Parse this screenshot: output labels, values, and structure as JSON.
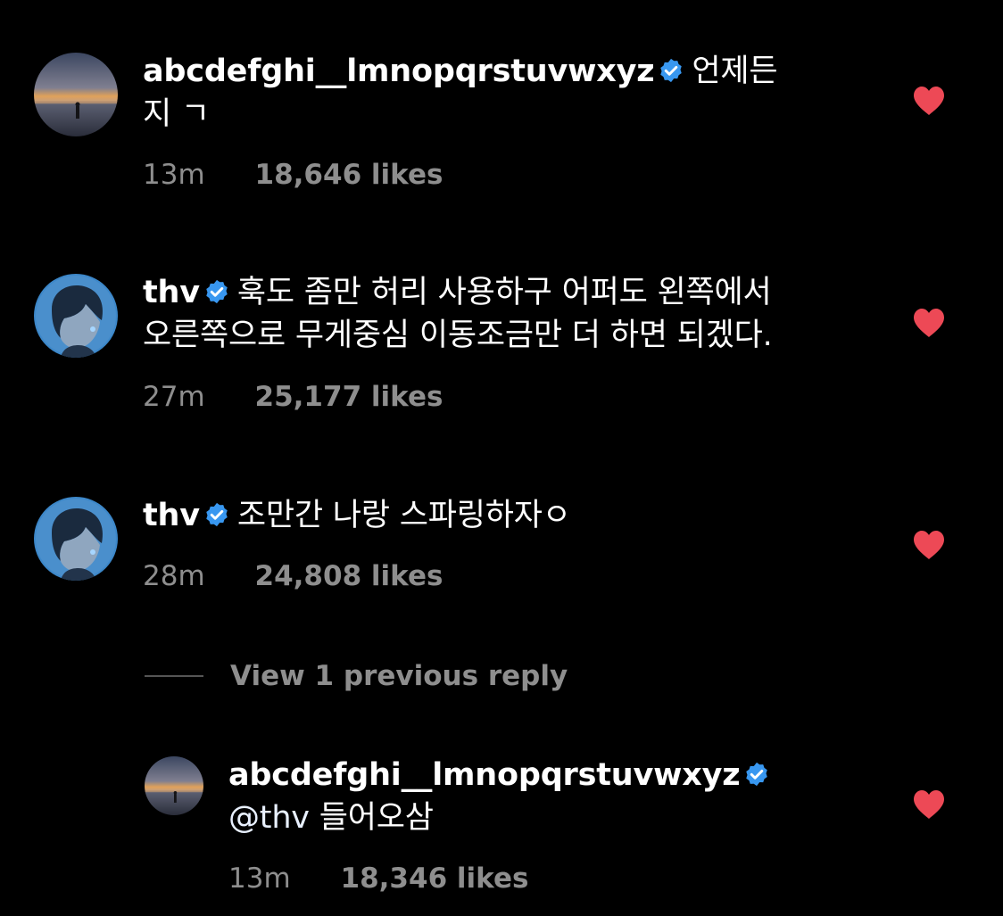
{
  "colors": {
    "background": "#000000",
    "text": "#ffffff",
    "muted": "#8e8e8e",
    "verified_badge": "#3897f0",
    "heart": "#ed4956"
  },
  "icons": {
    "verified": "verified-badge-icon",
    "like": "heart-filled-icon"
  },
  "comments": [
    {
      "username": "abcdefghi__lmnopqrstuvwxyz",
      "verified": true,
      "text_line1": "언제든",
      "text_line2": "지 ㄱ",
      "time": "13m",
      "likes": "18,646 likes",
      "liked": true
    },
    {
      "username": "thv",
      "verified": true,
      "text_line1": "훅도 좀만 허리 사용하구 어퍼도 왼쪽에서",
      "text_line2": "오른쪽으로 무게중심 이동조금만 더 하면 되겠다.",
      "time": "27m",
      "likes": "25,177 likes",
      "liked": true
    },
    {
      "username": "thv",
      "verified": true,
      "text_line1": "조만간 나랑 스파링하자ㅇ",
      "time": "28m",
      "likes": "24,808 likes",
      "liked": true
    }
  ],
  "view_replies": "View 1 previous reply",
  "reply": {
    "username": "abcdefghi__lmnopqrstuvwxyz",
    "verified": true,
    "mention": "@thv",
    "text": " 들어오삼",
    "time": "13m",
    "likes": "18,346 likes",
    "liked": true
  }
}
